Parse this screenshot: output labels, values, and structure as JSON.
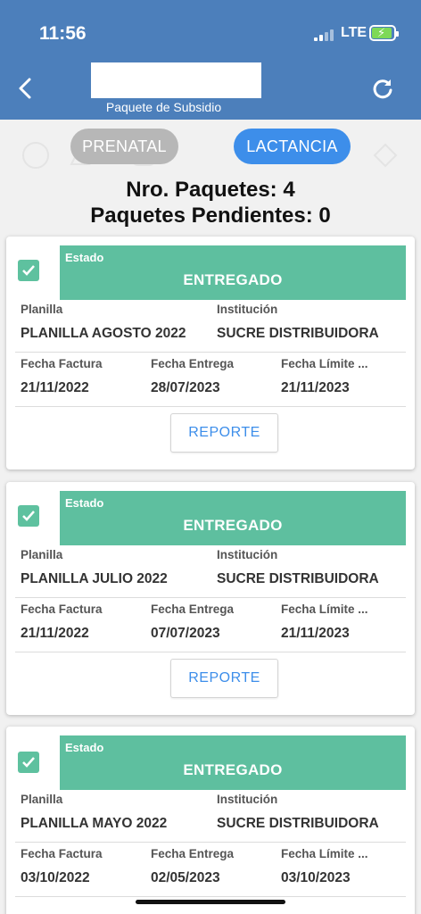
{
  "status_bar": {
    "time": "11:56",
    "network": "LTE"
  },
  "header": {
    "subtitle": "Paquete de Subsidio",
    "back_icon": "chevron-left-icon",
    "refresh_icon": "refresh-icon"
  },
  "tabs": [
    {
      "label": "PRENATAL",
      "active": false
    },
    {
      "label": "LACTANCIA",
      "active": true
    }
  ],
  "summary": {
    "paquetes": "Nro. Paquetes: 4",
    "pendientes": "Paquetes Pendientes: 0"
  },
  "labels": {
    "estado": "Estado",
    "planilla": "Planilla",
    "institucion": "Institución",
    "fecha_factura": "Fecha Factura",
    "fecha_entrega": "Fecha Entrega",
    "fecha_limite": "Fecha Límite ...",
    "reporte": "REPORTE"
  },
  "cards": [
    {
      "estado": "ENTREGADO",
      "planilla": "PLANILLA AGOSTO 2022",
      "institucion": "SUCRE DISTRIBUIDORA",
      "fecha_factura": "21/11/2022",
      "fecha_entrega": "28/07/2023",
      "fecha_limite": "21/11/2023"
    },
    {
      "estado": "ENTREGADO",
      "planilla": "PLANILLA JULIO 2022",
      "institucion": "SUCRE DISTRIBUIDORA",
      "fecha_factura": "21/11/2022",
      "fecha_entrega": "07/07/2023",
      "fecha_limite": "21/11/2023"
    },
    {
      "estado": "ENTREGADO",
      "planilla": "PLANILLA MAYO 2022",
      "institucion": "SUCRE DISTRIBUIDORA",
      "fecha_factura": "03/10/2022",
      "fecha_entrega": "02/05/2023",
      "fecha_limite": "03/10/2023"
    }
  ],
  "colors": {
    "header": "#4c7fbb",
    "estado": "#5ebf9f",
    "tab_active": "#3d8eea",
    "tab_inactive": "#b7b7b7"
  }
}
